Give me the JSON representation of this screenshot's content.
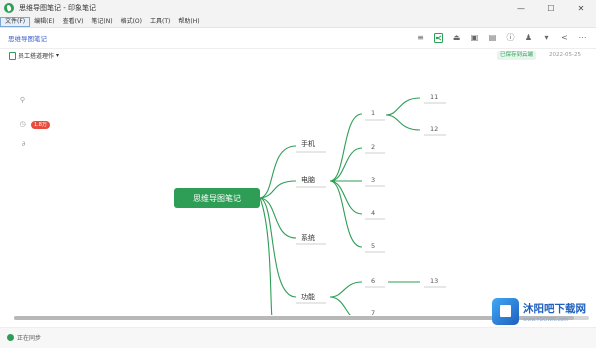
{
  "window": {
    "title": "思维导图笔记 - 印象笔记",
    "controls": [
      "—",
      "☐",
      "✕"
    ]
  },
  "menu": [
    "文件(F)",
    "编辑(E)",
    "查看(V)",
    "笔记(N)",
    "格式(O)",
    "工具(T)",
    "帮助(H)"
  ],
  "toolbar": {
    "breadcrumb": "思维导图笔记"
  },
  "notebook": {
    "name": "员工搭道理作"
  },
  "sync_status": "已保存到云端",
  "date": "2022-05-25",
  "side": {
    "badge": "1.8万"
  },
  "mindmap": {
    "root": "思维导图笔记",
    "branches": {
      "b1": "手机",
      "b2": "电脑",
      "b3": "系统",
      "b4": "功能"
    },
    "leaves": {
      "l1": "1",
      "l2": "2",
      "l3": "3",
      "l4": "4",
      "l5": "5",
      "l6": "6",
      "l7": "7",
      "l11": "11",
      "l12": "12",
      "l13": "13"
    }
  },
  "statusbar": {
    "label": "正在同步"
  },
  "watermark": {
    "title": "沐阳吧下载网",
    "subtitle": "www.YDOWN.com"
  },
  "colors": {
    "brand": "#2e9e56",
    "accent": "#3a5fcd",
    "badge": "#e74c3c"
  }
}
